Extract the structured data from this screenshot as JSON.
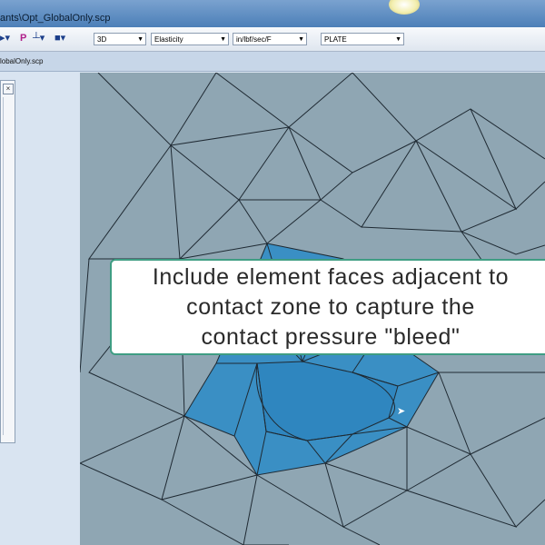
{
  "window": {
    "title": "ants\\Opt_GlobalOnly.scp"
  },
  "toolbar": {
    "combos": [
      {
        "value": "3D"
      },
      {
        "value": "Elasticity"
      },
      {
        "value": "in/lbf/sec/F"
      },
      {
        "value": "PLATE"
      }
    ]
  },
  "document_tab": {
    "label": "lobalOnly.scp"
  },
  "callout": {
    "message": "Include element faces adjacent to\ncontact zone to capture the\ncontact pressure \"bleed\""
  },
  "colors": {
    "mesh_background": "#8fa6b3",
    "contact_zone": "#3a8fc4",
    "callout_border": "#3f9d83"
  },
  "icons": [
    "mesh-tool-icon",
    "pointer-icon",
    "pressure-icon",
    "view-icon",
    "dropdown-arrow-icon",
    "close-icon",
    "mouse-cursor-icon"
  ]
}
